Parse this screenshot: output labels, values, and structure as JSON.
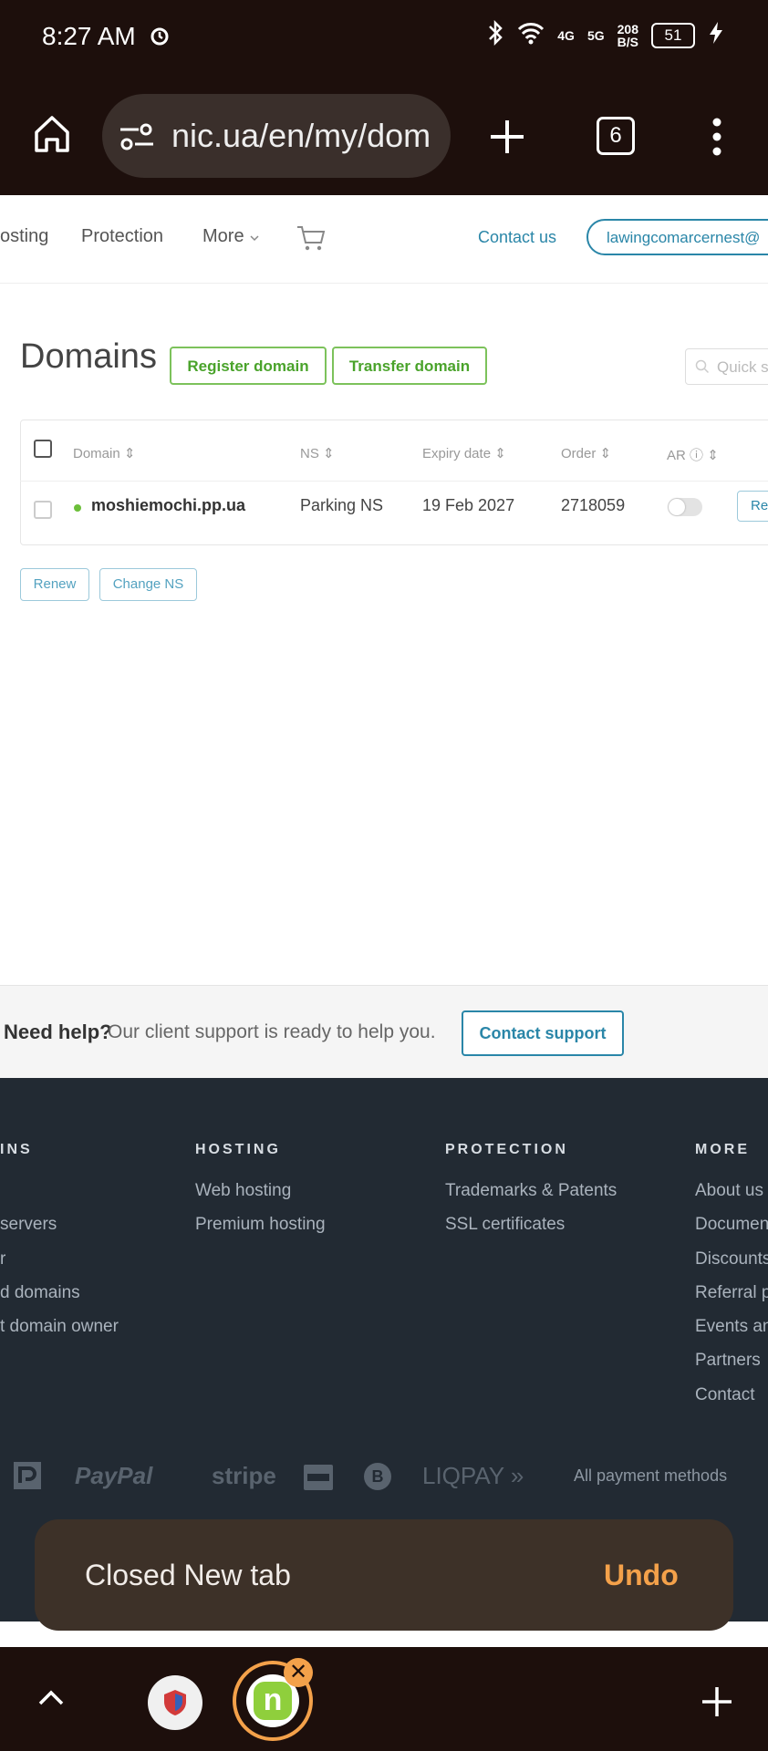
{
  "status_bar": {
    "time": "8:27 AM",
    "net1": "4G",
    "net2": "5G",
    "speed_value": "208",
    "speed_unit": "B/S",
    "battery": "51"
  },
  "browser": {
    "url": "nic.ua/en/my/dom",
    "tab_count": "6"
  },
  "site_nav": {
    "items": [
      "osting",
      "Protection",
      "More"
    ],
    "contact": "Contact us",
    "account": "lawingcomarcernest@"
  },
  "page": {
    "title": "Domains",
    "register_button": "Register domain",
    "transfer_button": "Transfer domain",
    "quick_search_placeholder": "Quick s"
  },
  "table": {
    "columns": [
      "Domain",
      "NS",
      "Expiry date",
      "Order",
      "AR"
    ],
    "rows": [
      {
        "domain": "moshiemochi.pp.ua",
        "ns": "Parking NS",
        "expiry": "19 Feb 2027",
        "order": "2718059",
        "ar": false,
        "action": "Re"
      }
    ],
    "bulk_actions": [
      "Renew",
      "Change NS"
    ]
  },
  "help": {
    "strong": "Need help?",
    "text": "Our client support is ready to help you.",
    "button": "Contact support"
  },
  "footer": {
    "columns": [
      {
        "heading": "INS",
        "links": [
          "servers",
          "r",
          "d domains",
          "t domain owner"
        ]
      },
      {
        "heading": "HOSTING",
        "links": [
          "Web hosting",
          "Premium hosting"
        ]
      },
      {
        "heading": "PROTECTION",
        "links": [
          "Trademarks & Patents",
          "SSL certificates"
        ]
      },
      {
        "heading": "MORE",
        "links": [
          "About us",
          "Documen",
          "Discounts",
          "Referral p",
          "Events an",
          "Partners",
          "Contact"
        ]
      }
    ],
    "payments": [
      "PayPal",
      "stripe",
      "LIQPAY »"
    ],
    "all_payments": "All payment methods"
  },
  "snackbar": {
    "text": "Closed New tab",
    "action": "Undo"
  },
  "tab_strip": {
    "active_tab_letter": "n"
  }
}
